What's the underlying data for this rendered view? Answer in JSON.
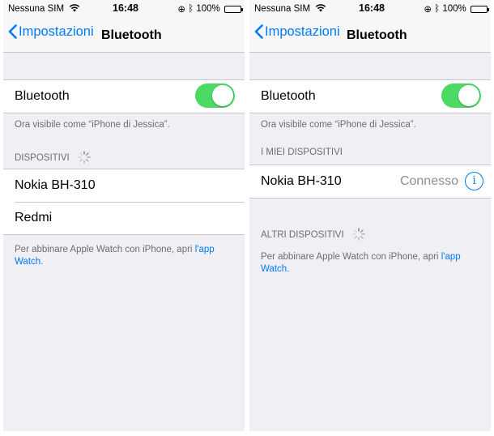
{
  "colors": {
    "accent": "#007aff",
    "toggle_on": "#4cd964",
    "background": "#efeff4",
    "secondary_text": "#6d6d72"
  },
  "left": {
    "status": {
      "carrier": "Nessuna SIM",
      "time": "16:48",
      "battery": "100%"
    },
    "nav": {
      "back_label": "Impostazioni",
      "title": "Bluetooth"
    },
    "bluetooth": {
      "label": "Bluetooth",
      "toggle_on": true
    },
    "visible_note": "Ora visibile come “iPhone di Jessica”.",
    "devices_header": "DISPOSITIVI",
    "devices": [
      {
        "name": "Nokia BH-310"
      },
      {
        "name": "Redmi"
      }
    ],
    "footer": {
      "text": "Per abbinare Apple Watch con iPhone, apri ",
      "link": "l'app Watch",
      "end": "."
    }
  },
  "right": {
    "status": {
      "carrier": "Nessuna SIM",
      "time": "16:48",
      "battery": "100%"
    },
    "nav": {
      "back_label": "Impostazioni",
      "title": "Bluetooth"
    },
    "bluetooth": {
      "label": "Bluetooth",
      "toggle_on": true
    },
    "visible_note": "Ora visibile come “iPhone di Jessica”.",
    "my_devices_header": "I MIEI DISPOSITIVI",
    "my_devices": [
      {
        "name": "Nokia BH-310",
        "status": "Connesso",
        "info_icon": "info-icon"
      }
    ],
    "other_devices_header": "ALTRI DISPOSITIVI",
    "footer": {
      "text": "Per abbinare Apple Watch con iPhone, apri ",
      "link": "l'app Watch",
      "end": "."
    }
  }
}
